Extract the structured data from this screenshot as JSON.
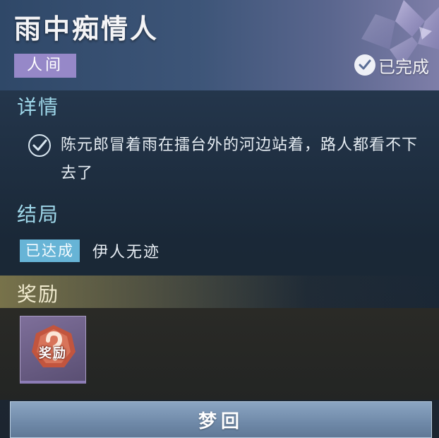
{
  "header": {
    "title": "雨中痴情人",
    "tag": "人间",
    "status": "已完成"
  },
  "details": {
    "heading": "详情",
    "items": [
      {
        "text": "陈元郎冒着雨在擂台外的河边站着，路人都看不下去了",
        "checked": true
      }
    ]
  },
  "ending": {
    "heading": "结局",
    "badge": "已达成",
    "text": "伊人无迹"
  },
  "reward": {
    "heading": "奖励",
    "items": [
      {
        "label": "奖励",
        "icon": "mystery-reward-icon"
      }
    ]
  },
  "actions": {
    "dream_return": "梦回"
  },
  "colors": {
    "accent_cyan": "#9fd8ea",
    "tag_purple": "#9688c8",
    "ending_badge": "#67b4d6",
    "reward_gold": "#c4b05c",
    "button": "#7f99b8"
  }
}
